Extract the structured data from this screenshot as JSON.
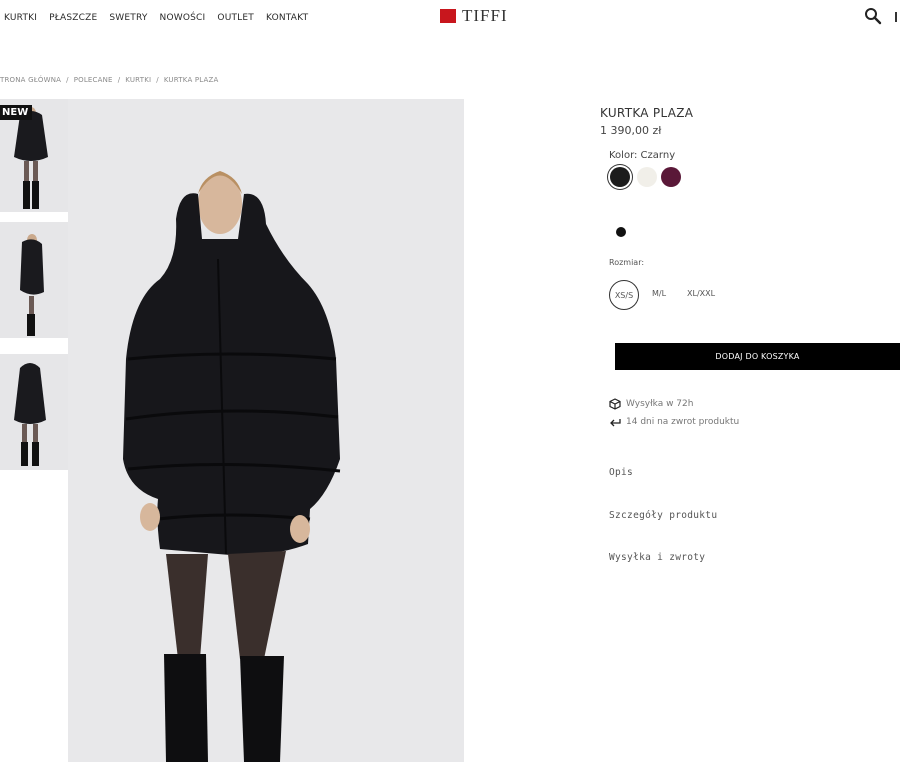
{
  "header": {
    "nav": [
      "KURTKI",
      "PŁASZCZE",
      "SWETRY",
      "NOWOŚCI",
      "OUTLET",
      "KONTAKT"
    ],
    "logo_text": "TIFFI",
    "search_icon": "search-icon"
  },
  "breadcrumb": [
    "TRONA GŁÓWNA",
    "POLECANE",
    "KURTKI",
    "KURTKA PLAZA"
  ],
  "gallery": {
    "badge": "NEW"
  },
  "product": {
    "name": "KURTKA PLAZA",
    "price": "1 390,00 zł",
    "color_label": "Kolor: Czarny",
    "swatches": [
      "#1c1c1c",
      "#f1efe9",
      "#5a1838"
    ],
    "size_label": "Rozmiar:",
    "sizes": [
      "XS/S",
      "M/L",
      "XL/XXL"
    ],
    "selected_size": "XS/S",
    "add_to_cart": "DODAJ DO KOSZYKA",
    "shipping": "Wysyłka w 72h",
    "returns": "14 dni na zwrot produktu",
    "accordions": [
      "Opis",
      "Szczegóły produktu",
      "Wysyłka i zwroty"
    ]
  },
  "colors": {
    "brand_red": "#c8161d",
    "button_black": "#000000"
  }
}
